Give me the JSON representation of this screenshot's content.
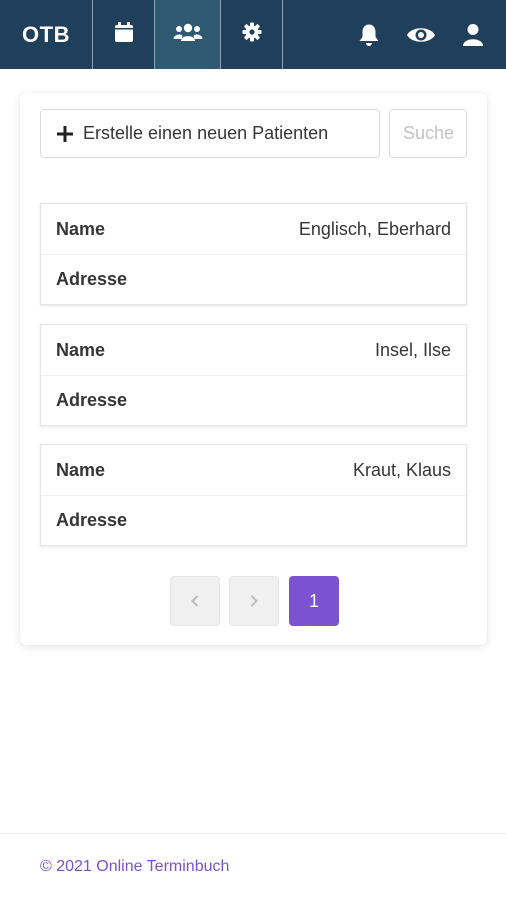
{
  "nav": {
    "brand": "OTB",
    "items": [
      {
        "icon": "calendar-icon"
      },
      {
        "icon": "users-icon",
        "active": true
      },
      {
        "icon": "gear-icon"
      }
    ],
    "right_icons": [
      "bell-icon",
      "eye-icon",
      "user-icon"
    ],
    "color": "#1f3f5b"
  },
  "toolbar": {
    "create_label": "Erstelle einen neuen Patienten",
    "search_placeholder": "Suche"
  },
  "patients": [
    {
      "name_label": "Name",
      "name": "Englisch, Eberhard",
      "address_label": "Adresse",
      "address": ""
    },
    {
      "name_label": "Name",
      "name": "Insel, Ilse",
      "address_label": "Adresse",
      "address": ""
    },
    {
      "name_label": "Name",
      "name": "Kraut, Klaus",
      "address_label": "Adresse",
      "address": ""
    }
  ],
  "pagination": {
    "prev": "‹",
    "next": "›",
    "current": "1",
    "accent": "#7b52d1"
  },
  "footer": {
    "text": "© 2021 Online Terminbuch"
  }
}
